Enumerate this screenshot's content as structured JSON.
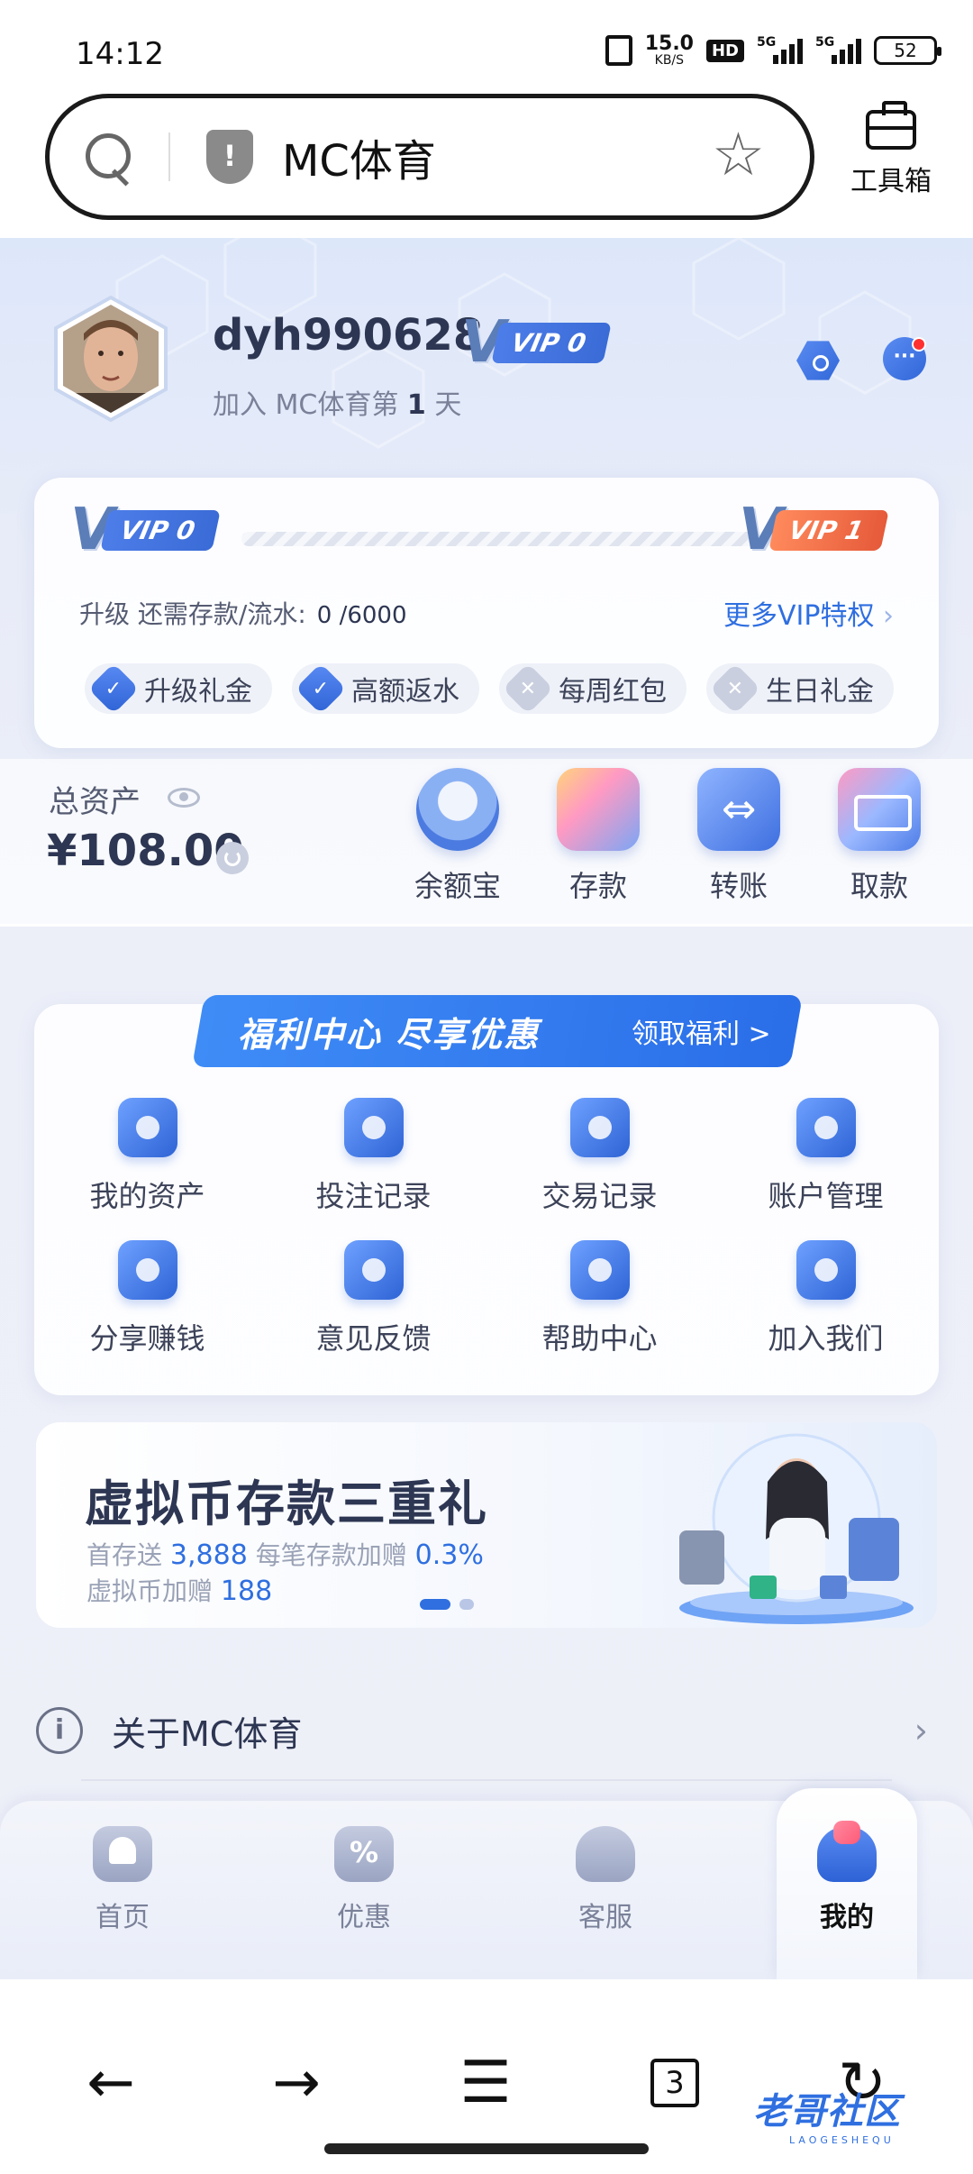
{
  "status_bar": {
    "time": "14:12",
    "net_speed": "15.0",
    "net_unit": "KB/S",
    "hd_badge": "HD",
    "sig1_label": "5G",
    "sig2_label": "5G",
    "battery": "52"
  },
  "address_bar": {
    "url_text": "MC体育",
    "toolbox_label": "工具箱"
  },
  "profile": {
    "username": "dyh990628",
    "vip_level": "VIP 0",
    "joined_prefix": "加入 MC体育第 ",
    "joined_days": "1",
    "joined_suffix": " 天"
  },
  "vip_card": {
    "current_level": "VIP 0",
    "next_level": "VIP 1",
    "upgrade_label": "升级 还需存款/流水:",
    "upgrade_value": "0 /6000",
    "upgrade_progress": 0,
    "more_link": "更多VIP特权",
    "perks": [
      {
        "label": "升级礼金",
        "enabled": true
      },
      {
        "label": "高额返水",
        "enabled": true
      },
      {
        "label": "每周红包",
        "enabled": false
      },
      {
        "label": "生日礼金",
        "enabled": false
      }
    ]
  },
  "assets": {
    "label": "总资产",
    "amount": "¥108.00",
    "actions": [
      {
        "label": "余额宝",
        "icon": "balance-treasure-icon"
      },
      {
        "label": "存款",
        "icon": "wallet-deposit-icon"
      },
      {
        "label": "转账",
        "icon": "transfer-icon"
      },
      {
        "label": "取款",
        "icon": "card-withdraw-icon"
      }
    ]
  },
  "welfare": {
    "banner_title": "福利中心 尽享优惠",
    "banner_cta": "领取福利 >",
    "items": [
      {
        "label": "我的资产",
        "icon": "wallet-icon"
      },
      {
        "label": "投注记录",
        "icon": "clock-record-icon"
      },
      {
        "label": "交易记录",
        "icon": "exchange-icon"
      },
      {
        "label": "账户管理",
        "icon": "account-folder-icon"
      },
      {
        "label": "分享赚钱",
        "icon": "share-coin-icon"
      },
      {
        "label": "意见反馈",
        "icon": "feedback-chat-icon"
      },
      {
        "label": "帮助中心",
        "icon": "help-question-icon"
      },
      {
        "label": "加入我们",
        "icon": "join-user-icon"
      }
    ]
  },
  "promo": {
    "title": "虚拟币存款三重礼",
    "line1_a": "首存送 ",
    "line1_b": "3,888",
    "line1_c": " 每笔存款加赠 ",
    "line1_d": "0.3%",
    "line2_a": "虚拟币加赠 ",
    "line2_b": "188",
    "active_slide": 0,
    "slide_count": 2
  },
  "about": {
    "label": "关于MC体育"
  },
  "tabbar": {
    "items": [
      {
        "label": "首页",
        "icon": "home-icon"
      },
      {
        "label": "优惠",
        "icon": "discount-icon"
      },
      {
        "label": "客服",
        "icon": "headset-icon"
      },
      {
        "label": "我的",
        "icon": "user-icon"
      }
    ],
    "active": 3
  },
  "browser_nav": {
    "tab_count": "3"
  },
  "watermark": {
    "text": "老哥社区",
    "sub": "LAOGESHEQU"
  },
  "colors": {
    "accent": "#2f6fe0",
    "text_dark": "#2d3652",
    "page_bg": "#eef0f8"
  }
}
